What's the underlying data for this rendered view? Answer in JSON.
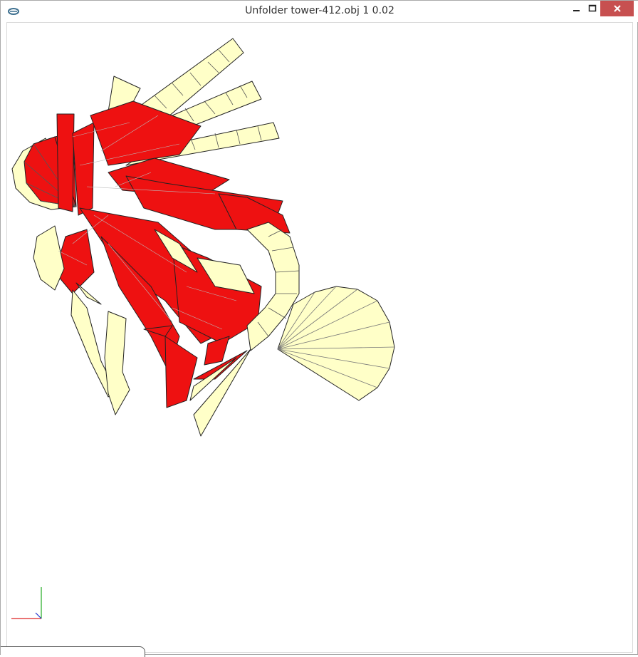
{
  "window": {
    "title": "Unfolder tower-412.obj 1 0.02",
    "controls": {
      "minimize": "minimize-icon",
      "maximize": "maximize-icon",
      "close": "close-icon"
    }
  },
  "colors": {
    "fill_red": "#ee1111",
    "fill_cream": "#ffffc8",
    "edge": "#222222",
    "fold_line": "#999999",
    "axis_x": "#dd2222",
    "axis_y": "#22aa22",
    "axis_z": "#2233cc",
    "close_bg": "#c75050"
  }
}
